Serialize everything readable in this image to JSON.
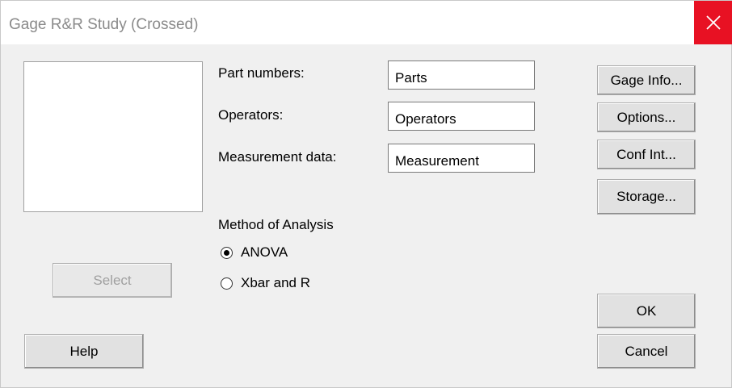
{
  "window": {
    "title": "Gage R&R Study (Crossed)",
    "close_icon": "close-icon",
    "close_color": "#e81123"
  },
  "variables_list": {
    "items": []
  },
  "fields": {
    "part_numbers": {
      "label": "Part numbers:",
      "value": "Parts"
    },
    "operators": {
      "label": "Operators:",
      "value": "Operators"
    },
    "measurement_data": {
      "label": "Measurement data:",
      "value": "Measurement"
    }
  },
  "method": {
    "heading": "Method of Analysis",
    "options": [
      {
        "label": "ANOVA",
        "checked": true
      },
      {
        "label": "Xbar and R",
        "checked": false
      }
    ]
  },
  "buttons": {
    "gage_info": "Gage Info...",
    "options": "Options...",
    "conf_int": "Conf Int...",
    "storage": "Storage...",
    "select": "Select",
    "help": "Help",
    "ok": "OK",
    "cancel": "Cancel"
  }
}
